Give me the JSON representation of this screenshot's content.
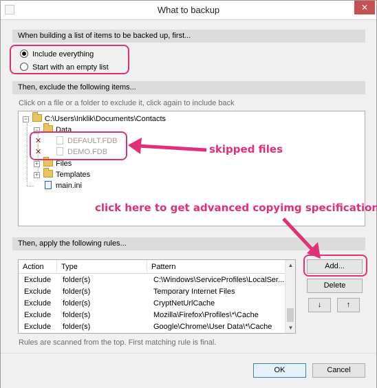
{
  "window": {
    "title": "What to backup",
    "close_label": "✕"
  },
  "section1": {
    "header": "When building a list of items to be backed up, first...",
    "options": [
      {
        "label": "Include everything",
        "checked": true
      },
      {
        "label": "Start with an empty list",
        "checked": false
      }
    ]
  },
  "section2": {
    "header": "Then, exclude the following items...",
    "hint": "Click on a file or a folder to exclude it, click again to include back",
    "tree": {
      "root": "C:\\Users\\Inklik\\Documents\\Contacts",
      "data_folder": "Data",
      "excluded_files": [
        "DEFAULT.FDB",
        "DEMO.FDB"
      ],
      "files_folder": "Files",
      "templates_folder": "Templates",
      "ini_file": "main.ini",
      "expander_minus": "−",
      "expander_plus": "+",
      "exclude_mark": "✕"
    }
  },
  "section3": {
    "header": "Then, apply the following rules...",
    "columns": [
      "Action",
      "Type",
      "Pattern"
    ],
    "rows": [
      [
        "Exclude",
        "folder(s)",
        "C:\\Windows\\ServiceProfiles\\LocalSer..."
      ],
      [
        "Exclude",
        "folder(s)",
        "Temporary Internet Files"
      ],
      [
        "Exclude",
        "folder(s)",
        "CryptNetUrlCache"
      ],
      [
        "Exclude",
        "folder(s)",
        "Mozilla\\Firefox\\Profiles\\*\\Cache"
      ],
      [
        "Exclude",
        "folder(s)",
        "Google\\Chrome\\User Data\\*\\Cache"
      ]
    ],
    "buttons": {
      "add": "Add...",
      "delete": "Delete",
      "down": "↓",
      "up": "↑"
    },
    "footnote": "Rules are scanned from the top. First matching rule is final."
  },
  "footer": {
    "ok": "OK",
    "cancel": "Cancel"
  },
  "annotations": {
    "skipped": "skipped files",
    "advanced": "click here to get advanced copyimg specifications",
    "color": "#e0307a"
  },
  "icons": [
    "app-icon",
    "close-icon",
    "folder-icon",
    "file-icon",
    "exclude-x-icon",
    "scroll-up-icon",
    "scroll-down-icon"
  ]
}
